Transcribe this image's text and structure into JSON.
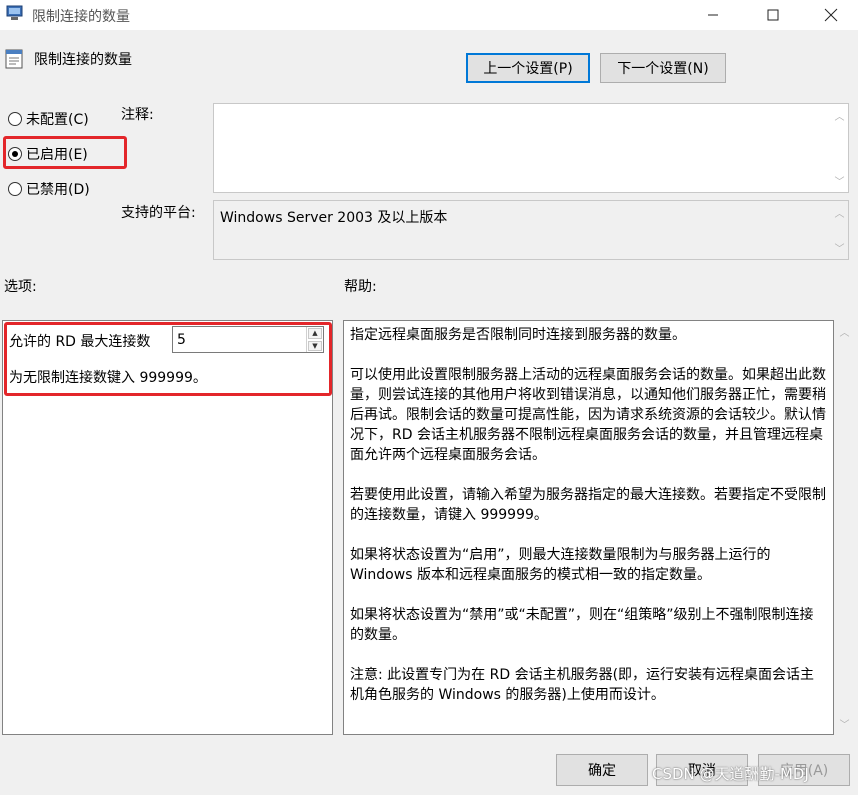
{
  "window": {
    "title": "限制连接的数量",
    "minimize_icon": "minimize-icon",
    "maximize_icon": "maximize-icon",
    "close_icon": "close-icon"
  },
  "header": {
    "policy_title": "限制连接的数量",
    "prev_button": "上一个设置(P)",
    "next_button": "下一个设置(N)"
  },
  "state": {
    "options": [
      {
        "label": "未配置(C)",
        "checked": false
      },
      {
        "label": "已启用(E)",
        "checked": true
      },
      {
        "label": "已禁用(D)",
        "checked": false
      }
    ]
  },
  "comment": {
    "label": "注释:",
    "value": ""
  },
  "platform": {
    "label": "支持的平台:",
    "value": "Windows Server 2003 及以上版本"
  },
  "options_section": {
    "label": "选项:",
    "max_connections_label": "允许的 RD 最大连接数",
    "max_connections_value": "5",
    "hint": "为无限制连接数键入 999999。"
  },
  "help_section": {
    "label": "帮助:",
    "paragraphs": [
      "指定远程桌面服务是否限制同时连接到服务器的数量。",
      "可以使用此设置限制服务器上活动的远程桌面服务会话的数量。如果超出此数量，则尝试连接的其他用户将收到错误消息，以通知他们服务器正忙，需要稍后再试。限制会话的数量可提高性能，因为请求系统资源的会话较少。默认情况下，RD 会话主机服务器不限制远程桌面服务会话的数量，并且管理远程桌面允许两个远程桌面服务会话。",
      "若要使用此设置，请输入希望为服务器指定的最大连接数。若要指定不受限制的连接数量，请键入 999999。",
      "如果将状态设置为“启用”，则最大连接数量限制为与服务器上运行的 Windows 版本和远程桌面服务的模式相一致的指定数量。",
      "如果将状态设置为“禁用”或“未配置”，则在“组策略”级别上不强制限制连接的数量。",
      "注意: 此设置专门为在 RD 会话主机服务器(即，运行安装有远程桌面会话主机角色服务的 Windows 的服务器)上使用而设计。"
    ]
  },
  "footer": {
    "ok_button": "确定",
    "cancel_button": "取消",
    "apply_button": "应用(A)"
  },
  "watermark": "CSDN @天道酬勤-MDJ"
}
